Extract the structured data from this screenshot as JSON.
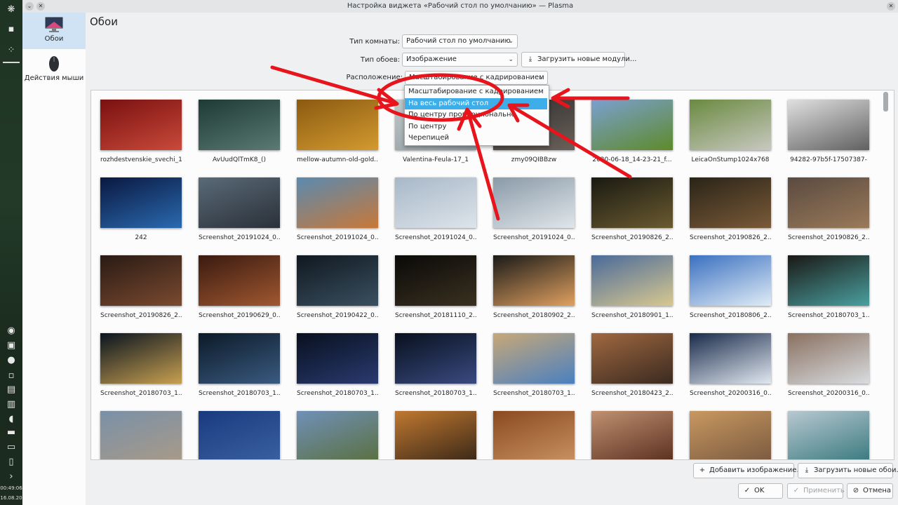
{
  "window": {
    "title": "Настройка виджета «Рабочий стол по умолчанию» — Plasma",
    "left_buttons": [
      "⌄",
      "✕"
    ],
    "right_button": "✕"
  },
  "panel": {
    "time": "00:49:06",
    "date": "16.08.20"
  },
  "categories": [
    {
      "label": "Обои",
      "icon": "monitor-icon",
      "selected": true
    },
    {
      "label": "Действия мыши",
      "icon": "mouse-icon",
      "selected": false
    }
  ],
  "page": {
    "heading": "Обои",
    "layout_label": "Тип комнаты:",
    "layout_value": "Рабочий стол по умолчанию",
    "type_label": "Тип обоев:",
    "type_value": "Изображение",
    "get_plugins": "Загрузить новые модули...",
    "position_label": "Расположение:",
    "position_value": "Масштабирование с кадрированием"
  },
  "dropdown": {
    "options": [
      "Масштабирование с кадрированием",
      "На весь рабочий стол",
      "По центру пропорционально",
      "По центру",
      "Черепицей"
    ],
    "highlighted": 1
  },
  "wallpapers": [
    {
      "name": "rozhdestvenskie_svechi_1",
      "c1": "#7a1010",
      "c2": "#c94a3a"
    },
    {
      "name": "AvUudQlTmK8_()",
      "c1": "#1e3a35",
      "c2": "#5a7a72"
    },
    {
      "name": "mellow-autumn-old-gold...",
      "c1": "#8a5a10",
      "c2": "#d49a30"
    },
    {
      "name": "Valentina-Feula-17_1",
      "c1": "#c0c8c8",
      "c2": "#909aa0"
    },
    {
      "name": "zmy09QIBBzw",
      "c1": "#2e2e2e",
      "c2": "#6a6058"
    },
    {
      "name": "2020-06-18_14-23-21_f...",
      "c1": "#7aa0d0",
      "c2": "#5e8a2a"
    },
    {
      "name": "LeicaOnStump1024x768",
      "c1": "#6a8a40",
      "c2": "#c8c8c0"
    },
    {
      "name": "94282-97b5f-17507387-",
      "c1": "#e0e0e0",
      "c2": "#606060"
    },
    {
      "name": "242",
      "c1": "#0a1840",
      "c2": "#2a6ab0"
    },
    {
      "name": "Screenshot_20191024_0...",
      "c1": "#5a6a78",
      "c2": "#2a3038"
    },
    {
      "name": "Screenshot_20191024_0...",
      "c1": "#5a8ab0",
      "c2": "#c87838"
    },
    {
      "name": "Screenshot_20191024_0...",
      "c1": "#a8b8c8",
      "c2": "#dde4ea"
    },
    {
      "name": "Screenshot_20191024_0...",
      "c1": "#8a9aa8",
      "c2": "#e0e6ea"
    },
    {
      "name": "Screenshot_20190826_2...",
      "c1": "#1a1a12",
      "c2": "#6a5a30"
    },
    {
      "name": "Screenshot_20190826_2...",
      "c1": "#2a2418",
      "c2": "#7a5a38"
    },
    {
      "name": "Screenshot_20190826_2...",
      "c1": "#5a4a40",
      "c2": "#9a7a5a"
    },
    {
      "name": "Screenshot_20190826_2...",
      "c1": "#2a1a14",
      "c2": "#7a4a30"
    },
    {
      "name": "Screenshot_20190629_0...",
      "c1": "#3a1a10",
      "c2": "#a05830"
    },
    {
      "name": "Screenshot_20190422_0...",
      "c1": "#101820",
      "c2": "#3a5060"
    },
    {
      "name": "Screenshot_20181110_2...",
      "c1": "#0a0a08",
      "c2": "#3a3020"
    },
    {
      "name": "Screenshot_20180902_2...",
      "c1": "#1a1a18",
      "c2": "#e0a060"
    },
    {
      "name": "Screenshot_20180901_1...",
      "c1": "#4a6a9a",
      "c2": "#d8c890"
    },
    {
      "name": "Screenshot_20180806_2...",
      "c1": "#3a70c0",
      "c2": "#e0ecf6"
    },
    {
      "name": "Screenshot_20180703_1...",
      "c1": "#1a1814",
      "c2": "#4aa0a0"
    },
    {
      "name": "Screenshot_20180703_1...",
      "c1": "#0a1420",
      "c2": "#c8a050"
    },
    {
      "name": "Screenshot_20180703_1...",
      "c1": "#0c1a28",
      "c2": "#3a5a80"
    },
    {
      "name": "Screenshot_20180703_1...",
      "c1": "#08101e",
      "c2": "#2a3a70"
    },
    {
      "name": "Screenshot_20180703_1...",
      "c1": "#08101e",
      "c2": "#3a4a80"
    },
    {
      "name": "Screenshot_20180703_1...",
      "c1": "#c8a878",
      "c2": "#4a80c0"
    },
    {
      "name": "Screenshot_20180423_2...",
      "c1": "#a06840",
      "c2": "#3a2a20"
    },
    {
      "name": "Screenshot_20200316_0...",
      "c1": "#1a2a4a",
      "c2": "#e0e8f0"
    },
    {
      "name": "Screenshot_20200316_0...",
      "c1": "#8a7060",
      "c2": "#d8dce0"
    },
    {
      "name": "",
      "c1": "#7a90a8",
      "c2": "#a89a88"
    },
    {
      "name": "",
      "c1": "#1a3a80",
      "c2": "#3a60a0"
    },
    {
      "name": "",
      "c1": "#7090b8",
      "c2": "#5a7040"
    },
    {
      "name": "",
      "c1": "#c07830",
      "c2": "#3a2818"
    },
    {
      "name": "",
      "c1": "#8a4a20",
      "c2": "#c89060"
    },
    {
      "name": "",
      "c1": "#c09070",
      "c2": "#5a3020"
    },
    {
      "name": "",
      "c1": "#c89860",
      "c2": "#7a5a40"
    },
    {
      "name": "",
      "c1": "#b8c8d0",
      "c2": "#3a7a80"
    }
  ],
  "bottom": {
    "add_image": "Добавить изображение...",
    "get_wallpapers": "Загрузить новые обои...",
    "ok": "OK",
    "apply": "Применить",
    "cancel": "Отмена"
  },
  "annotation_color": "#e8141c"
}
